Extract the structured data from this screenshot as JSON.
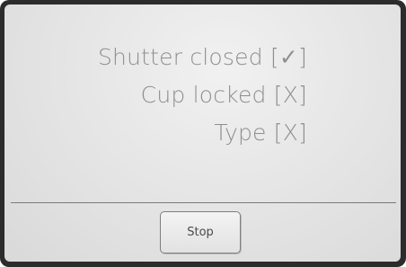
{
  "status": {
    "items": [
      {
        "text": "Shutter closed [✓]"
      },
      {
        "text": "Cup locked [X]"
      },
      {
        "text": "Type [X]"
      }
    ]
  },
  "actions": {
    "stop_label": "Stop"
  },
  "colors": {
    "bezel": "#2c2c2c",
    "screen_background": "#e6e6e6",
    "status_text": "#8f8f8f",
    "divider": "#7a7a7a"
  }
}
